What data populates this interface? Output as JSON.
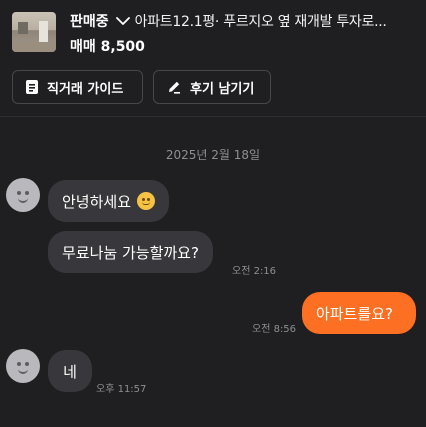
{
  "listing": {
    "status": "판매중",
    "title": "아파트12.1평· 푸르지오 옆 재개발 투자로...",
    "price": "매매 8,500"
  },
  "actions": {
    "guide_label": "직거래 가이드",
    "review_label": "후기 남기기"
  },
  "chat": {
    "date": "2025년 2월 18일",
    "messages": [
      {
        "sender": "other",
        "text": "안녕하세요",
        "time": ""
      },
      {
        "sender": "other",
        "text": "무료나눔 가능할까요?",
        "time": "오전 2:16"
      },
      {
        "sender": "me",
        "text": "아파트를요?",
        "time": "오전 8:56"
      },
      {
        "sender": "other",
        "text": "네",
        "time": "오후 11:57"
      }
    ]
  },
  "colors": {
    "background": "#1f1f21",
    "bubble_other": "#38383c",
    "bubble_mine": "#fd6f22",
    "muted_text": "#8e8e93"
  },
  "icons": {
    "status_dropdown": "chevron-down-icon",
    "guide": "document-icon",
    "review": "pencil-icon",
    "emoji": "smiley-emoji-icon",
    "avatar": "user-avatar-icon"
  }
}
